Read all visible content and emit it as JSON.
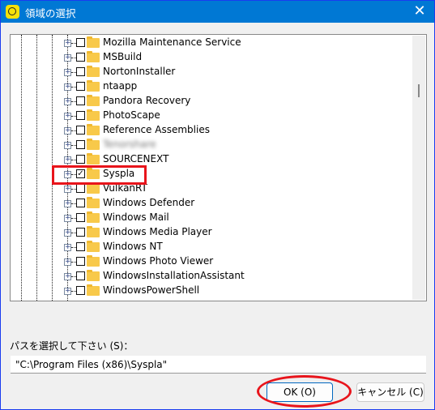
{
  "window": {
    "title": "領域の選択",
    "close_icon": "close-icon",
    "app_icon": "clock-check-icon"
  },
  "tree": {
    "items": [
      {
        "label": "Mozilla Maintenance Service",
        "checked": false
      },
      {
        "label": "MSBuild",
        "checked": false
      },
      {
        "label": "NortonInstaller",
        "checked": false
      },
      {
        "label": "ntaapp",
        "checked": false
      },
      {
        "label": "Pandora Recovery",
        "checked": false
      },
      {
        "label": "PhotoScape",
        "checked": false
      },
      {
        "label": "Reference Assemblies",
        "checked": false
      },
      {
        "label": "Tenorshare",
        "checked": false,
        "blurred": true
      },
      {
        "label": "SOURCENEXT",
        "checked": false
      },
      {
        "label": "Syspla",
        "checked": true
      },
      {
        "label": "VulkanRT",
        "checked": false
      },
      {
        "label": "Windows Defender",
        "checked": false
      },
      {
        "label": "Windows Mail",
        "checked": false
      },
      {
        "label": "Windows Media Player",
        "checked": false
      },
      {
        "label": "Windows NT",
        "checked": false
      },
      {
        "label": "Windows Photo Viewer",
        "checked": false
      },
      {
        "label": "WindowsInstallationAssistant",
        "checked": false
      },
      {
        "label": "WindowsPowerShell",
        "checked": false
      }
    ]
  },
  "path": {
    "label": "パスを選択して下さい (S)：",
    "value": "\"C:\\Program Files (x86)\\Syspla\""
  },
  "buttons": {
    "ok": "OK (O)",
    "cancel": "キャンセル (C)"
  },
  "colors": {
    "titlebar": "#0078d4",
    "highlight": "#e8141b"
  }
}
